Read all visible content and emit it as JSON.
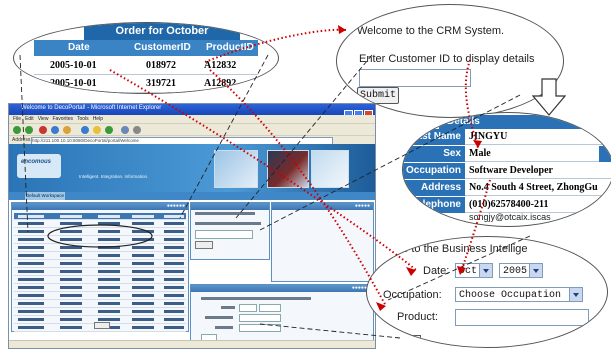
{
  "browser": {
    "title": "Welcome to DecoPortal! - Microsoft Internet Explorer",
    "menu": [
      "File",
      "Edit",
      "View",
      "Favorites",
      "Tools",
      "Help"
    ],
    "address_label": "Address",
    "address": "http://211.100.10.10:8080/DecoPortal/portal/Welcome",
    "logo_text": "encomous",
    "slogan": "Intelligent. Integration. Information.",
    "nav_tab": "Default Workspace"
  },
  "order_table": {
    "title": "Order for October",
    "columns": [
      "Date",
      "CustomerID",
      "ProductID"
    ],
    "rows": [
      [
        "2005-10-01",
        "018972",
        "A12832"
      ],
      [
        "2005-10-01",
        "319721",
        "A12892"
      ]
    ]
  },
  "crm": {
    "welcome": "Welcome to the CRM System.",
    "prompt": "Enter Customer ID to display details",
    "submit": "Submit"
  },
  "details": {
    "title": "Details",
    "rows": [
      {
        "label": "Last Name",
        "value": "JINGYU"
      },
      {
        "label": "Sex",
        "value": "Male"
      },
      {
        "label": "Occupation",
        "value": "Software Developer"
      },
      {
        "label": "Address",
        "value": "No.4 South 4 Street, ZhongGu"
      },
      {
        "label": "Telephone",
        "value": "(010)62578400-211"
      }
    ],
    "email": "songjy@otcaix.iscas"
  },
  "bi": {
    "welcome": "me to the Business Intellige",
    "date_label": "Date:",
    "month": "Oct",
    "year": "2005",
    "occupation_label": "Occupation:",
    "occupation_value": "Choose Occupation",
    "product_label": "Product:"
  },
  "colors": {
    "annotation": "#cc0000",
    "header_blue": "#2a72b5"
  }
}
